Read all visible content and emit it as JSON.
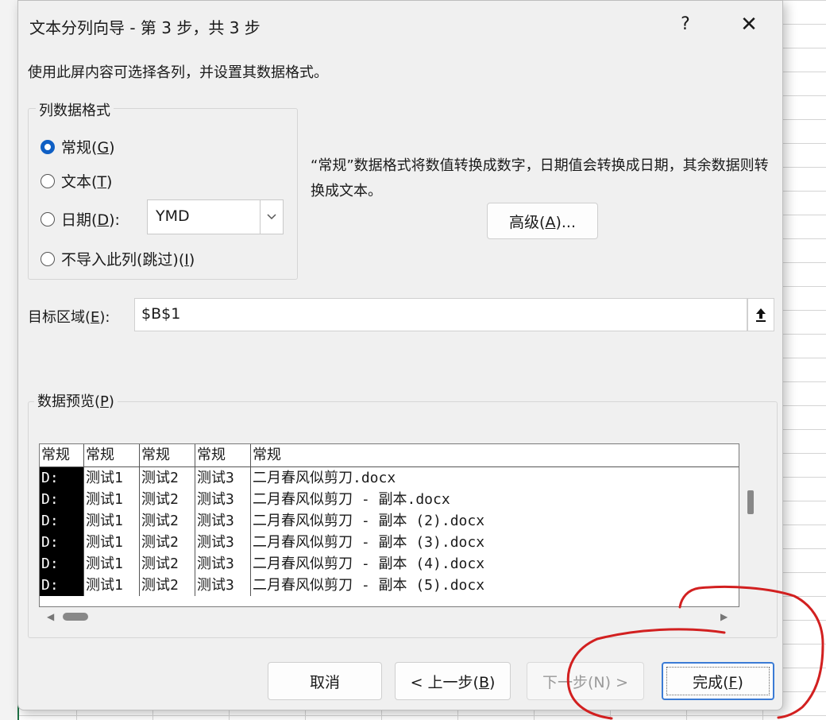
{
  "dialog": {
    "title": "文本分列向导 - 第 3 步，共 3 步",
    "help": "?",
    "close": "✕",
    "instruction": "使用此屏内容可选择各列，并设置其数据格式。"
  },
  "format_group": {
    "legend": "列数据格式",
    "options": [
      {
        "label": "常规",
        "key": "G",
        "checked": true
      },
      {
        "label": "文本",
        "key": "T",
        "checked": false
      },
      {
        "label": "日期",
        "key": "D",
        "checked": false
      },
      {
        "label": "不导入此列(跳过)",
        "key": "I",
        "checked": false
      }
    ],
    "date_value": "YMD"
  },
  "description": "“常规”数据格式将数值转换成数字，日期值会转换成日期，其余数据则转换成文本。",
  "advanced_button": {
    "label": "高级",
    "key": "A",
    "suffix": "..."
  },
  "target": {
    "label": "目标区域",
    "key": "E",
    "value": "$B$1"
  },
  "preview": {
    "legend": "数据预览",
    "key": "P",
    "headers": [
      "常规",
      "常规",
      "常规",
      "常规",
      "常规"
    ],
    "rows": [
      [
        "D:",
        "测试1",
        "测试2",
        "测试3",
        "二月春风似剪刀.docx"
      ],
      [
        "D:",
        "测试1",
        "测试2",
        "测试3",
        "二月春风似剪刀 - 副本.docx"
      ],
      [
        "D:",
        "测试1",
        "测试2",
        "测试3",
        "二月春风似剪刀 - 副本 (2).docx"
      ],
      [
        "D:",
        "测试1",
        "测试2",
        "测试3",
        "二月春风似剪刀 - 副本 (3).docx"
      ],
      [
        "D:",
        "测试1",
        "测试2",
        "测试3",
        "二月春风似剪刀 - 副本 (4).docx"
      ],
      [
        "D:",
        "测试1",
        "测试2",
        "测试3",
        "二月春风似剪刀 - 副本 (5).docx"
      ]
    ]
  },
  "buttons": {
    "cancel": "取消",
    "back": {
      "prefix": "< 上一步(",
      "key": "B",
      "suffix": ")"
    },
    "next": "下一步(N) >",
    "finish": {
      "prefix": "完成(",
      "key": "F",
      "suffix": ")"
    }
  },
  "colors": {
    "accent": "#0f5fc4",
    "annotation": "#d22020"
  },
  "icons": {
    "collapse": "upload-arrow-icon",
    "dropdown": "chevron-down-icon"
  }
}
